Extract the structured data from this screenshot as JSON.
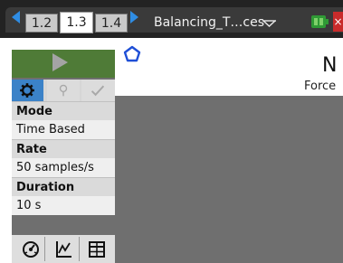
{
  "tabs": [
    {
      "label": "1.2",
      "active": false
    },
    {
      "label": "1.3",
      "active": true
    },
    {
      "label": "1.4",
      "active": false
    }
  ],
  "document_title": "Balancing_T…ces",
  "colors": {
    "accent_blue": "#2f8de4",
    "play_green": "#4f7b37",
    "panel_gray": "#6f6f6f",
    "gear_selected": "#3b82c8",
    "close_red": "#c92b2b"
  },
  "icons": {
    "left_arrow": "triangle-left-icon",
    "right_arrow": "triangle-right-icon",
    "doc_menu": "chevron-down-icon",
    "battery": "battery-icon",
    "close": "close-icon",
    "play": "play-icon",
    "settings": "gear-icon",
    "mark": "pin-icon",
    "keep": "check-icon",
    "meter_view": "meter-icon",
    "graph_view": "graph-icon",
    "table_view": "table-icon",
    "sensor": "pentagon-icon"
  },
  "settings_panel": {
    "mode_label": "Mode",
    "mode_value": "Time Based",
    "rate_label": "Rate",
    "rate_value": "50 samples/s",
    "duration_label": "Duration",
    "duration_value": "10 s"
  },
  "meter": {
    "reading": "N",
    "label": "Force"
  }
}
